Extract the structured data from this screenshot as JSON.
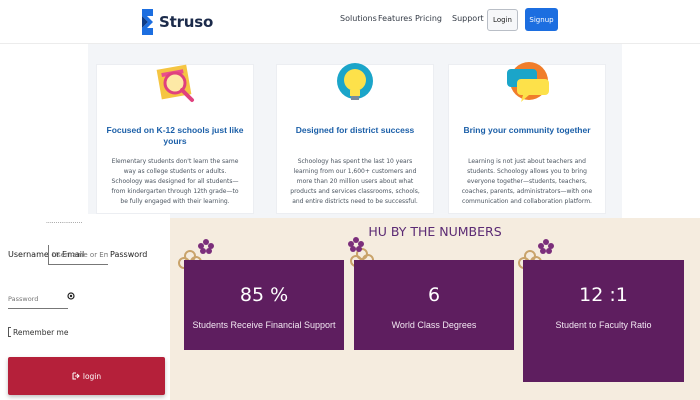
{
  "nav": {
    "brand": "Struso",
    "links": [
      "Solutions",
      "Features",
      "Pricing",
      "Support"
    ],
    "login_label": "Login",
    "signup_label": "Signup",
    "brand_color": "#1c6ee0"
  },
  "features": [
    {
      "icon": "magnifier-icon",
      "title": "Focused on K-12 schools just like yours",
      "body": "Elementary students don't learn the same way as college students or adults. Schoology was designed for all students—from kindergarten through 12th grade—to be fully engaged with their learning."
    },
    {
      "icon": "lightbulb-icon",
      "title": "Designed for district success",
      "body": "Schoology has spent the last 10 years learning from our 1,600+ customers and more than 20 million users about what products and services classrooms, schools, and entire districts need to be successful."
    },
    {
      "icon": "chat-bubbles-icon",
      "title": "Bring your community together",
      "body": "Learning is not just about teachers and students. Schoology allows you to bring everyone together—students, teachers, coaches, parents, administrators—with one communication and collaboration platform."
    }
  ],
  "login": {
    "header_text": "...................",
    "username_label": "Username or Email",
    "username_placeholder": "Username or Email",
    "password_label": "Password",
    "password_placeholder": "Password",
    "remember_label": "Remember me",
    "submit_label": "login",
    "submit_color": "#b5203a"
  },
  "numbers": {
    "title": "HU BY THE NUMBERS",
    "stats": [
      {
        "value": "85 %",
        "label": "Students Receive Financial Support"
      },
      {
        "value": "6",
        "label": "World Class Degrees"
      },
      {
        "value": "12 :1",
        "label": "Student to Faculty Ratio"
      }
    ],
    "card_color": "#5e1e5f",
    "background": "#f5ecdf"
  }
}
